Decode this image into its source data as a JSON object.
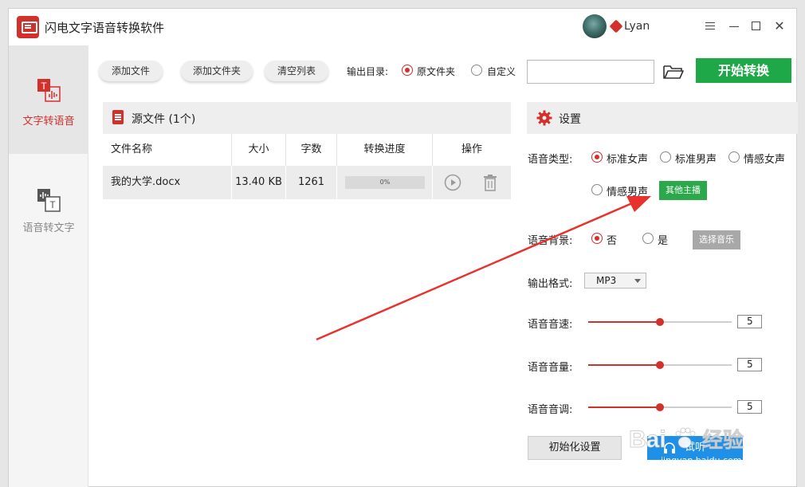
{
  "app": {
    "title": "闪电文字语音转换软件",
    "username": "Lyan"
  },
  "sidebar": {
    "items": [
      {
        "label": "文字转语音",
        "active": true
      },
      {
        "label": "语音转文字",
        "active": false
      }
    ]
  },
  "toolbar": {
    "add_file": "添加文件",
    "add_folder": "添加文件夹",
    "clear_list": "清空列表",
    "output_dir_label": "输出目录:",
    "output_options": [
      {
        "label": "原文件夹",
        "checked": true
      },
      {
        "label": "自定义",
        "checked": false
      }
    ],
    "path_value": "",
    "start_label": "开始转换"
  },
  "files": {
    "header": "源文件 (1个)",
    "columns": [
      "文件名称",
      "大小",
      "字数",
      "转换进度",
      "操作"
    ],
    "rows": [
      {
        "name": "我的大学.docx",
        "size": "13.40 KB",
        "words": "1261",
        "progress_text": "0%",
        "progress": 0
      }
    ]
  },
  "settings": {
    "header": "设置",
    "voice_type_label": "语音类型:",
    "voice_types": [
      {
        "label": "标准女声",
        "checked": true
      },
      {
        "label": "标准男声",
        "checked": false
      },
      {
        "label": "情感女声",
        "checked": false
      },
      {
        "label": "情感男声",
        "checked": false
      }
    ],
    "other_anchor": "其他主播",
    "background_label": "语音背景:",
    "background_options": [
      {
        "label": "否",
        "checked": true
      },
      {
        "label": "是",
        "checked": false
      }
    ],
    "choose_music": "选择音乐",
    "format_label": "输出格式:",
    "format_value": "MP3",
    "speed_label": "语音音速:",
    "speed_value": "5",
    "volume_label": "语音音量:",
    "volume_value": "5",
    "pitch_label": "语音音调:",
    "pitch_value": "5",
    "reset_label": "初始化设置",
    "listen_label": "试听"
  },
  "watermark": {
    "text": "Bai 经验",
    "sub": "jingyan.baidu.com"
  },
  "colors": {
    "accent_red": "#d2302b",
    "start_green": "#1fa847",
    "listen_blue": "#1e90e8",
    "annotation_arrow": "#e8322e"
  },
  "icons": {
    "folder": "folder-open-icon",
    "document": "document-icon",
    "settings": "gear-icon",
    "play": "play-icon",
    "delete": "trash-icon",
    "listen": "headphone-icon"
  }
}
